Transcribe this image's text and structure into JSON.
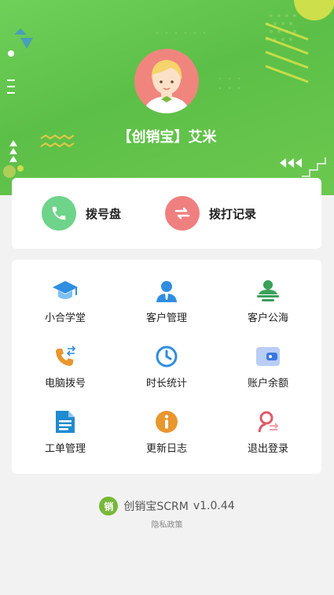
{
  "profile": {
    "name": "【创销宝】艾米"
  },
  "quick_actions": [
    {
      "label": "拨号盘",
      "icon": "phone-icon",
      "color": "#6dd48a"
    },
    {
      "label": "拨打记录",
      "icon": "swap-arrows-icon",
      "color": "#f08080"
    }
  ],
  "menu": [
    {
      "label": "小合学堂",
      "icon": "graduation-cap-icon"
    },
    {
      "label": "客户管理",
      "icon": "person-icon"
    },
    {
      "label": "客户公海",
      "icon": "person-pool-icon"
    },
    {
      "label": "电脑拨号",
      "icon": "phone-transfer-icon"
    },
    {
      "label": "时长统计",
      "icon": "clock-icon"
    },
    {
      "label": "账户余额",
      "icon": "wallet-icon"
    },
    {
      "label": "工单管理",
      "icon": "document-icon"
    },
    {
      "label": "更新日志",
      "icon": "info-icon"
    },
    {
      "label": "退出登录",
      "icon": "logout-icon"
    }
  ],
  "footer": {
    "logo_text": "销",
    "app_name": "创销宝SCRM",
    "version": "v1.0.44",
    "privacy": "隐私政策"
  },
  "colors": {
    "header_green": "#5cbf47",
    "accent_blue": "#2f8ee0",
    "accent_green": "#3aa05a",
    "accent_orange": "#e8962e"
  }
}
